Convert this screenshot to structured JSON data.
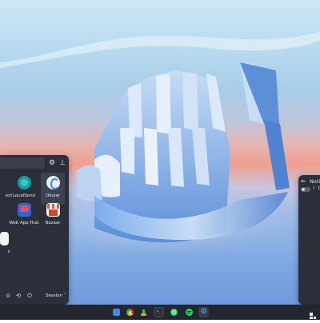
{
  "launcher": {
    "apps": [
      {
        "label": "ect",
        "icon": "app-icon",
        "color": "#4b6ea8"
      },
      {
        "label": "LocalSend",
        "icon": "localsend-icon",
        "color": "#1e9aa0"
      },
      {
        "label": "Okular",
        "icon": "okular-icon",
        "color": "#e9eef5"
      },
      {
        "label": "",
        "icon": "app-icon",
        "color": "#4d7fd3"
      },
      {
        "label": "Web App Hub",
        "icon": "web-app-hub-icon",
        "color": "#3565c9"
      },
      {
        "label": "Bazaar",
        "icon": "bazaar-icon",
        "color": "#e25a3b"
      },
      {
        "label": "s",
        "icon": "app-icon",
        "color": "#f2f2f2"
      }
    ],
    "session_label": "Session"
  },
  "notifications": {
    "title": "Noti",
    "dnd_label": "D"
  },
  "taskbar": {
    "items": [
      "file-manager-icon",
      "chrome-icon",
      "sound-icon",
      "terminal-icon",
      "whatsapp-icon",
      "spotify-icon",
      "settings-icon"
    ]
  }
}
